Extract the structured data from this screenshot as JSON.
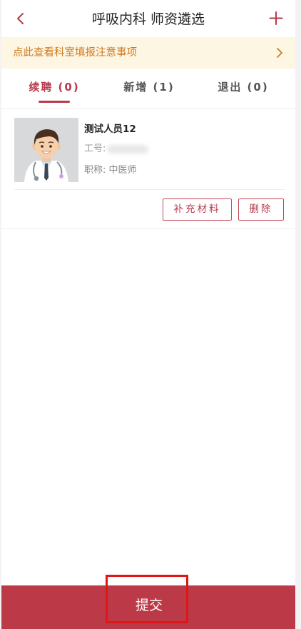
{
  "header": {
    "title": "呼吸内科 师资遴选",
    "back_icon": "chevron-left-icon",
    "add_icon": "plus-icon"
  },
  "notice": {
    "text": "点此查看科室填报注意事项",
    "icon": "chevron-right-icon"
  },
  "tabs": [
    {
      "label": "续聘 (0)",
      "active": true
    },
    {
      "label": "新增 (1)",
      "active": false
    },
    {
      "label": "退出 (0)",
      "active": false
    }
  ],
  "records": [
    {
      "name": "测试人员12",
      "employee_no_label": "工号:",
      "title_label": "职称:",
      "title_value": "中医师",
      "supplement_button": "补充材料",
      "delete_button": "删除"
    }
  ],
  "footer": {
    "submit_label": "提交"
  },
  "colors": {
    "accent": "#b8394a",
    "notice_bg": "#fdf6e3",
    "notice_text": "#cf7a1f"
  }
}
